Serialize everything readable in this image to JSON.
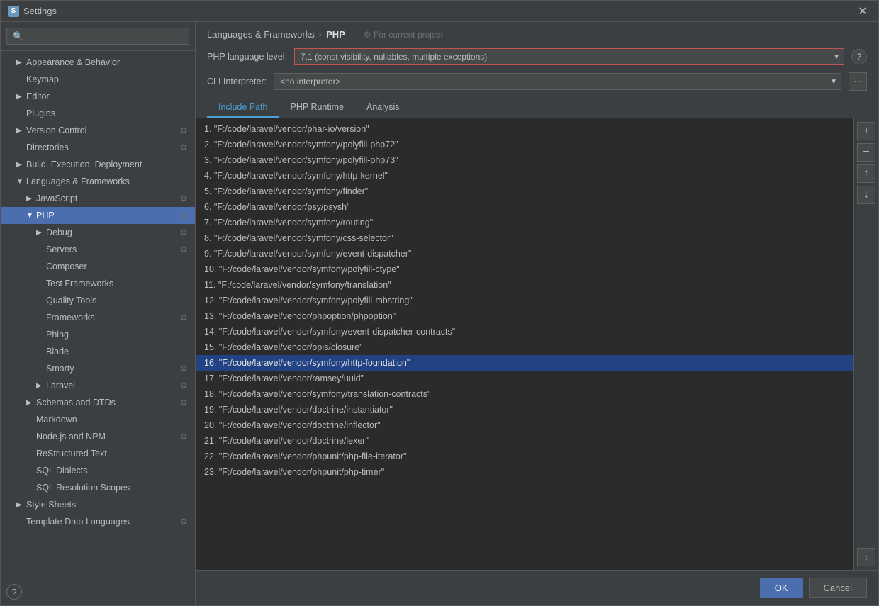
{
  "window": {
    "title": "Settings",
    "icon": "S"
  },
  "sidebar": {
    "search_placeholder": "🔍",
    "items": [
      {
        "id": "appearance",
        "label": "Appearance & Behavior",
        "indent": 1,
        "arrow": "▶",
        "has_gear": false
      },
      {
        "id": "keymap",
        "label": "Keymap",
        "indent": 1,
        "arrow": "",
        "has_gear": false
      },
      {
        "id": "editor",
        "label": "Editor",
        "indent": 1,
        "arrow": "▶",
        "has_gear": false
      },
      {
        "id": "plugins",
        "label": "Plugins",
        "indent": 1,
        "arrow": "",
        "has_gear": false
      },
      {
        "id": "version-control",
        "label": "Version Control",
        "indent": 1,
        "arrow": "▶",
        "has_gear": true
      },
      {
        "id": "directories",
        "label": "Directories",
        "indent": 1,
        "arrow": "",
        "has_gear": true
      },
      {
        "id": "build",
        "label": "Build, Execution, Deployment",
        "indent": 1,
        "arrow": "▶",
        "has_gear": false
      },
      {
        "id": "languages",
        "label": "Languages & Frameworks",
        "indent": 1,
        "arrow": "▼",
        "has_gear": false
      },
      {
        "id": "javascript",
        "label": "JavaScript",
        "indent": 2,
        "arrow": "▶",
        "has_gear": true
      },
      {
        "id": "php",
        "label": "PHP",
        "indent": 2,
        "arrow": "▼",
        "has_gear": true,
        "selected": true
      },
      {
        "id": "debug",
        "label": "Debug",
        "indent": 3,
        "arrow": "▶",
        "has_gear": true
      },
      {
        "id": "servers",
        "label": "Servers",
        "indent": 3,
        "arrow": "",
        "has_gear": true
      },
      {
        "id": "composer",
        "label": "Composer",
        "indent": 3,
        "arrow": "",
        "has_gear": false
      },
      {
        "id": "test-frameworks",
        "label": "Test Frameworks",
        "indent": 3,
        "arrow": "",
        "has_gear": false
      },
      {
        "id": "quality-tools",
        "label": "Quality Tools",
        "indent": 3,
        "arrow": "",
        "has_gear": false
      },
      {
        "id": "frameworks",
        "label": "Frameworks",
        "indent": 3,
        "arrow": "",
        "has_gear": true
      },
      {
        "id": "phing",
        "label": "Phing",
        "indent": 3,
        "arrow": "",
        "has_gear": false
      },
      {
        "id": "blade",
        "label": "Blade",
        "indent": 3,
        "arrow": "",
        "has_gear": false
      },
      {
        "id": "smarty",
        "label": "Smarty",
        "indent": 3,
        "arrow": "",
        "has_gear": true
      },
      {
        "id": "laravel",
        "label": "Laravel",
        "indent": 3,
        "arrow": "▶",
        "has_gear": true
      },
      {
        "id": "schemas",
        "label": "Schemas and DTDs",
        "indent": 2,
        "arrow": "▶",
        "has_gear": true
      },
      {
        "id": "markdown",
        "label": "Markdown",
        "indent": 2,
        "arrow": "",
        "has_gear": false
      },
      {
        "id": "nodejs",
        "label": "Node.js and NPM",
        "indent": 2,
        "arrow": "",
        "has_gear": true
      },
      {
        "id": "restructured",
        "label": "ReStructured Text",
        "indent": 2,
        "arrow": "",
        "has_gear": false
      },
      {
        "id": "sql-dialects",
        "label": "SQL Dialects",
        "indent": 2,
        "arrow": "",
        "has_gear": false
      },
      {
        "id": "sql-resolution",
        "label": "SQL Resolution Scopes",
        "indent": 2,
        "arrow": "",
        "has_gear": false
      },
      {
        "id": "stylesheets",
        "label": "Style Sheets",
        "indent": 1,
        "arrow": "▶",
        "has_gear": false
      },
      {
        "id": "template-data",
        "label": "Template Data Languages",
        "indent": 1,
        "arrow": "",
        "has_gear": true
      }
    ],
    "help_label": "?"
  },
  "header": {
    "breadcrumb_parent": "Languages & Frameworks",
    "breadcrumb_sep": "›",
    "breadcrumb_current": "PHP",
    "for_project_icon": "⚙",
    "for_project_label": "For current project"
  },
  "form": {
    "php_level_label": "PHP language level:",
    "php_level_value": "7.1 (const visibility, nullables, multiple exceptions)",
    "cli_label": "CLI Interpreter:",
    "cli_value": "<no interpreter>",
    "help_icon": "?"
  },
  "tabs": [
    {
      "id": "include-path",
      "label": "Include Path",
      "active": true
    },
    {
      "id": "php-runtime",
      "label": "PHP Runtime",
      "active": false
    },
    {
      "id": "analysis",
      "label": "Analysis",
      "active": false
    }
  ],
  "paths": [
    {
      "num": 1,
      "path": "\"F:/code/laravel/vendor/phar-io/version\""
    },
    {
      "num": 2,
      "path": "\"F:/code/laravel/vendor/symfony/polyfill-php72\""
    },
    {
      "num": 3,
      "path": "\"F:/code/laravel/vendor/symfony/polyfill-php73\""
    },
    {
      "num": 4,
      "path": "\"F:/code/laravel/vendor/symfony/http-kernel\""
    },
    {
      "num": 5,
      "path": "\"F:/code/laravel/vendor/symfony/finder\""
    },
    {
      "num": 6,
      "path": "\"F:/code/laravel/vendor/psy/psysh\""
    },
    {
      "num": 7,
      "path": "\"F:/code/laravel/vendor/symfony/routing\""
    },
    {
      "num": 8,
      "path": "\"F:/code/laravel/vendor/symfony/css-selector\""
    },
    {
      "num": 9,
      "path": "\"F:/code/laravel/vendor/symfony/event-dispatcher\""
    },
    {
      "num": 10,
      "path": "\"F:/code/laravel/vendor/symfony/polyfill-ctype\""
    },
    {
      "num": 11,
      "path": "\"F:/code/laravel/vendor/symfony/translation\""
    },
    {
      "num": 12,
      "path": "\"F:/code/laravel/vendor/symfony/polyfill-mbstring\""
    },
    {
      "num": 13,
      "path": "\"F:/code/laravel/vendor/phpoption/phpoption\""
    },
    {
      "num": 14,
      "path": "\"F:/code/laravel/vendor/symfony/event-dispatcher-contracts\""
    },
    {
      "num": 15,
      "path": "\"F:/code/laravel/vendor/opis/closure\""
    },
    {
      "num": 16,
      "path": "\"F:/code/laravel/vendor/symfony/http-foundation\"",
      "highlighted": true
    },
    {
      "num": 17,
      "path": "\"F:/code/laravel/vendor/ramsey/uuid\""
    },
    {
      "num": 18,
      "path": "\"F:/code/laravel/vendor/symfony/translation-contracts\""
    },
    {
      "num": 19,
      "path": "\"F:/code/laravel/vendor/doctrine/instantiator\""
    },
    {
      "num": 20,
      "path": "\"F:/code/laravel/vendor/doctrine/inflector\""
    },
    {
      "num": 21,
      "path": "\"F:/code/laravel/vendor/doctrine/lexer\""
    },
    {
      "num": 22,
      "path": "\"F:/code/laravel/vendor/phpunit/php-file-iterator\""
    },
    {
      "num": 23,
      "path": "\"F:/code/laravel/vendor/phpunit/php-timer\""
    }
  ],
  "toolbar_buttons": {
    "add": "+",
    "remove": "−",
    "up": "↑",
    "down": "↓",
    "sort": "↕"
  },
  "footer": {
    "ok_label": "OK",
    "cancel_label": "Cancel"
  }
}
